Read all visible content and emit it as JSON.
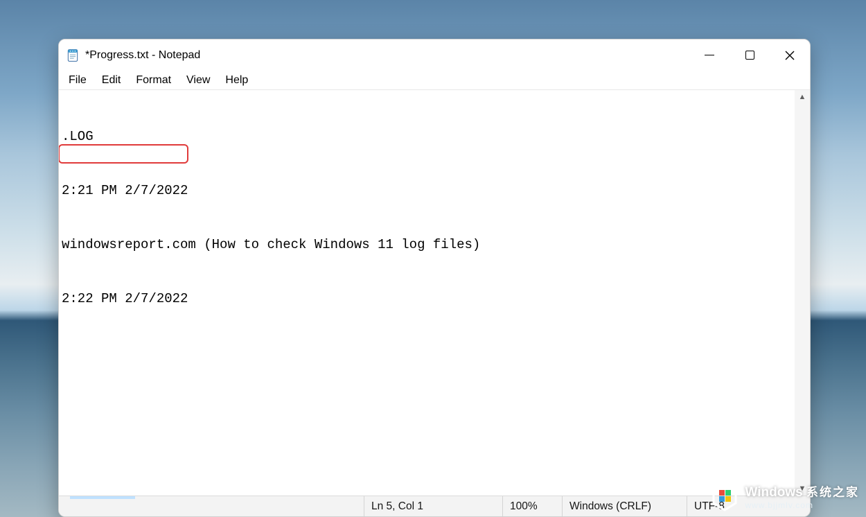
{
  "window": {
    "title": "*Progress.txt - Notepad"
  },
  "menu": {
    "items": [
      "File",
      "Edit",
      "Format",
      "View",
      "Help"
    ]
  },
  "editor": {
    "lines": [
      ".LOG",
      "2:21 PM 2/7/2022",
      "windowsreport.com (How to check Windows 11 log files)",
      "2:22 PM 2/7/2022"
    ],
    "highlight_line_index": 3
  },
  "status": {
    "position": "Ln 5, Col 1",
    "zoom": "100%",
    "line_ending": "Windows (CRLF)",
    "encoding": "UTF-8"
  },
  "watermark": {
    "brand": "Windows",
    "brand_cn": "系统之家",
    "url": "www.bjjmlv.com"
  }
}
